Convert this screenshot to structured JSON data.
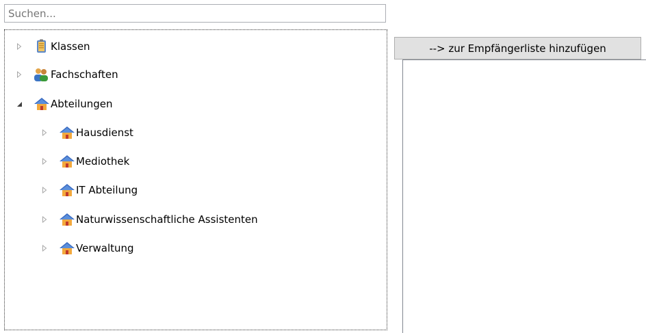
{
  "search": {
    "placeholder": "Suchen..."
  },
  "tree": {
    "nodes": [
      {
        "label": "Klassen",
        "icon": "folder-icon",
        "expanded": false
      },
      {
        "label": "Fachschaften",
        "icon": "people-icon",
        "expanded": false
      },
      {
        "label": "Abteilungen",
        "icon": "house-icon",
        "expanded": true,
        "children": [
          {
            "label": "Hausdienst",
            "icon": "house-icon"
          },
          {
            "label": "Mediothek",
            "icon": "house-icon"
          },
          {
            "label": "IT Abteilung",
            "icon": "house-icon"
          },
          {
            "label": "Naturwissenschaftliche Assistenten",
            "icon": "house-icon"
          },
          {
            "label": "Verwaltung",
            "icon": "house-icon"
          }
        ]
      }
    ]
  },
  "add_button": {
    "label": "--> zur Empfängerliste hinzufügen"
  },
  "recipient_list": {
    "items": []
  }
}
